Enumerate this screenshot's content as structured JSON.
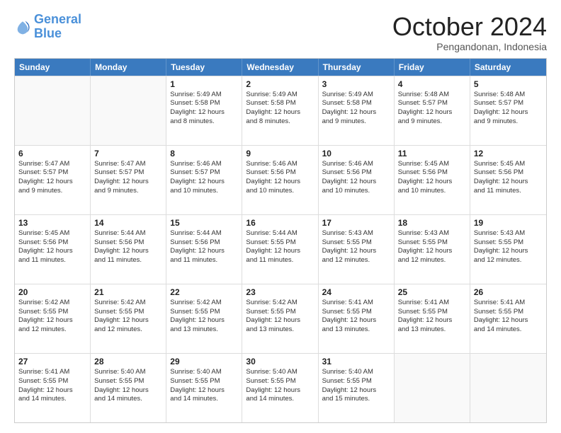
{
  "header": {
    "logo_line1": "General",
    "logo_line2": "Blue",
    "month": "October 2024",
    "location": "Pengandonan, Indonesia"
  },
  "days_of_week": [
    "Sunday",
    "Monday",
    "Tuesday",
    "Wednesday",
    "Thursday",
    "Friday",
    "Saturday"
  ],
  "weeks": [
    [
      {
        "day": "",
        "text": ""
      },
      {
        "day": "",
        "text": ""
      },
      {
        "day": "1",
        "text": "Sunrise: 5:49 AM\nSunset: 5:58 PM\nDaylight: 12 hours\nand 8 minutes."
      },
      {
        "day": "2",
        "text": "Sunrise: 5:49 AM\nSunset: 5:58 PM\nDaylight: 12 hours\nand 8 minutes."
      },
      {
        "day": "3",
        "text": "Sunrise: 5:49 AM\nSunset: 5:58 PM\nDaylight: 12 hours\nand 9 minutes."
      },
      {
        "day": "4",
        "text": "Sunrise: 5:48 AM\nSunset: 5:57 PM\nDaylight: 12 hours\nand 9 minutes."
      },
      {
        "day": "5",
        "text": "Sunrise: 5:48 AM\nSunset: 5:57 PM\nDaylight: 12 hours\nand 9 minutes."
      }
    ],
    [
      {
        "day": "6",
        "text": "Sunrise: 5:47 AM\nSunset: 5:57 PM\nDaylight: 12 hours\nand 9 minutes."
      },
      {
        "day": "7",
        "text": "Sunrise: 5:47 AM\nSunset: 5:57 PM\nDaylight: 12 hours\nand 9 minutes."
      },
      {
        "day": "8",
        "text": "Sunrise: 5:46 AM\nSunset: 5:57 PM\nDaylight: 12 hours\nand 10 minutes."
      },
      {
        "day": "9",
        "text": "Sunrise: 5:46 AM\nSunset: 5:56 PM\nDaylight: 12 hours\nand 10 minutes."
      },
      {
        "day": "10",
        "text": "Sunrise: 5:46 AM\nSunset: 5:56 PM\nDaylight: 12 hours\nand 10 minutes."
      },
      {
        "day": "11",
        "text": "Sunrise: 5:45 AM\nSunset: 5:56 PM\nDaylight: 12 hours\nand 10 minutes."
      },
      {
        "day": "12",
        "text": "Sunrise: 5:45 AM\nSunset: 5:56 PM\nDaylight: 12 hours\nand 11 minutes."
      }
    ],
    [
      {
        "day": "13",
        "text": "Sunrise: 5:45 AM\nSunset: 5:56 PM\nDaylight: 12 hours\nand 11 minutes."
      },
      {
        "day": "14",
        "text": "Sunrise: 5:44 AM\nSunset: 5:56 PM\nDaylight: 12 hours\nand 11 minutes."
      },
      {
        "day": "15",
        "text": "Sunrise: 5:44 AM\nSunset: 5:56 PM\nDaylight: 12 hours\nand 11 minutes."
      },
      {
        "day": "16",
        "text": "Sunrise: 5:44 AM\nSunset: 5:55 PM\nDaylight: 12 hours\nand 11 minutes."
      },
      {
        "day": "17",
        "text": "Sunrise: 5:43 AM\nSunset: 5:55 PM\nDaylight: 12 hours\nand 12 minutes."
      },
      {
        "day": "18",
        "text": "Sunrise: 5:43 AM\nSunset: 5:55 PM\nDaylight: 12 hours\nand 12 minutes."
      },
      {
        "day": "19",
        "text": "Sunrise: 5:43 AM\nSunset: 5:55 PM\nDaylight: 12 hours\nand 12 minutes."
      }
    ],
    [
      {
        "day": "20",
        "text": "Sunrise: 5:42 AM\nSunset: 5:55 PM\nDaylight: 12 hours\nand 12 minutes."
      },
      {
        "day": "21",
        "text": "Sunrise: 5:42 AM\nSunset: 5:55 PM\nDaylight: 12 hours\nand 12 minutes."
      },
      {
        "day": "22",
        "text": "Sunrise: 5:42 AM\nSunset: 5:55 PM\nDaylight: 12 hours\nand 13 minutes."
      },
      {
        "day": "23",
        "text": "Sunrise: 5:42 AM\nSunset: 5:55 PM\nDaylight: 12 hours\nand 13 minutes."
      },
      {
        "day": "24",
        "text": "Sunrise: 5:41 AM\nSunset: 5:55 PM\nDaylight: 12 hours\nand 13 minutes."
      },
      {
        "day": "25",
        "text": "Sunrise: 5:41 AM\nSunset: 5:55 PM\nDaylight: 12 hours\nand 13 minutes."
      },
      {
        "day": "26",
        "text": "Sunrise: 5:41 AM\nSunset: 5:55 PM\nDaylight: 12 hours\nand 14 minutes."
      }
    ],
    [
      {
        "day": "27",
        "text": "Sunrise: 5:41 AM\nSunset: 5:55 PM\nDaylight: 12 hours\nand 14 minutes."
      },
      {
        "day": "28",
        "text": "Sunrise: 5:40 AM\nSunset: 5:55 PM\nDaylight: 12 hours\nand 14 minutes."
      },
      {
        "day": "29",
        "text": "Sunrise: 5:40 AM\nSunset: 5:55 PM\nDaylight: 12 hours\nand 14 minutes."
      },
      {
        "day": "30",
        "text": "Sunrise: 5:40 AM\nSunset: 5:55 PM\nDaylight: 12 hours\nand 14 minutes."
      },
      {
        "day": "31",
        "text": "Sunrise: 5:40 AM\nSunset: 5:55 PM\nDaylight: 12 hours\nand 15 minutes."
      },
      {
        "day": "",
        "text": ""
      },
      {
        "day": "",
        "text": ""
      }
    ]
  ]
}
